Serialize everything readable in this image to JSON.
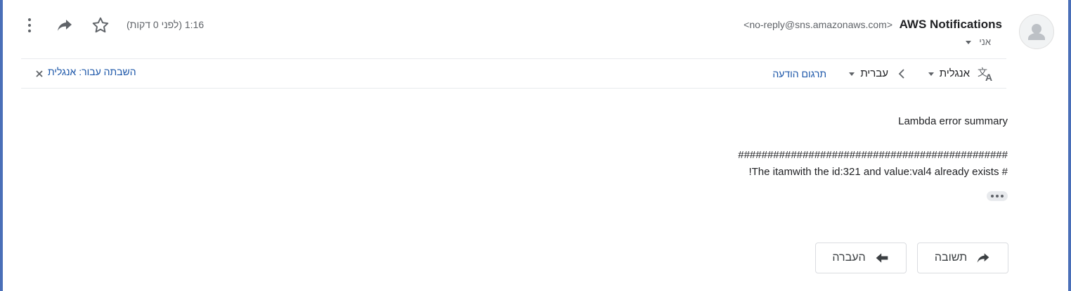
{
  "header": {
    "sender_name": "AWS Notifications",
    "sender_email": "<no-reply@sns.amazonaws.com>",
    "recipient": "אני",
    "timestamp": "1:16 (לפני 0 דקות)"
  },
  "icons": {
    "avatar": "person-icon",
    "more": "more-vert-icon",
    "forward": "forward-icon",
    "star": "star-outline-icon",
    "translate": "translate-icon",
    "swap": "chevron-left-icon",
    "close": "close-icon"
  },
  "translation_bar": {
    "source_language": "אנגלית",
    "target_language": "עברית",
    "translate_link": "תרגום הודעה",
    "disable_link": "השבתה עבור: אנגלית"
  },
  "message": {
    "line1": "Lambda error  summary",
    "line2": "##############################################",
    "line3": "# The itamwith the id:321 and value:val4 already exists!"
  },
  "actions": {
    "reply_label": "תשובה",
    "forward_label": "העברה"
  }
}
